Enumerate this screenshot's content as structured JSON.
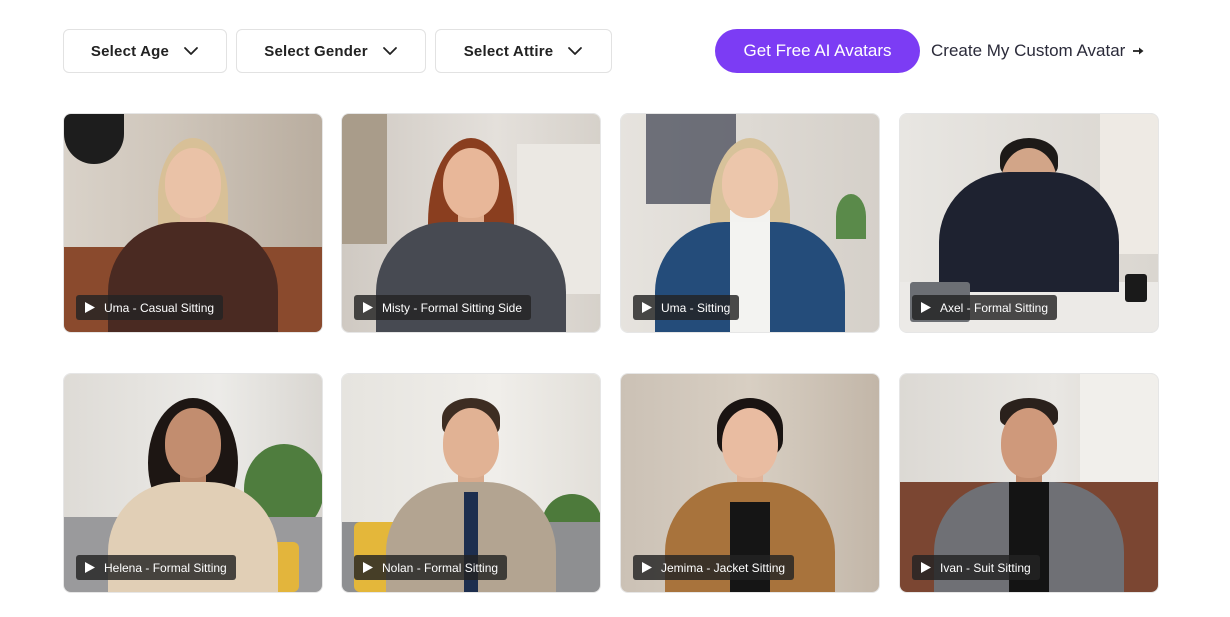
{
  "filters": {
    "age": "Select Age",
    "gender": "Select Gender",
    "attire": "Select Attire"
  },
  "cta": {
    "label": "Get Free AI Avatars"
  },
  "custom_link": {
    "label": "Create My Custom Avatar"
  },
  "icons": {
    "dropdown": "chevron-down-icon",
    "arrow": "arrow-right-icon",
    "play": "play-icon"
  },
  "colors": {
    "accent": "#7c3cf4"
  },
  "avatars": [
    {
      "name": "Uma - Casual Sitting"
    },
    {
      "name": "Misty - Formal Sitting Side"
    },
    {
      "name": "Uma - Sitting"
    },
    {
      "name": "Axel - Formal Sitting"
    },
    {
      "name": "Helena - Formal Sitting"
    },
    {
      "name": "Nolan - Formal Sitting"
    },
    {
      "name": "Jemima - Jacket Sitting"
    },
    {
      "name": "Ivan - Suit Sitting"
    }
  ]
}
